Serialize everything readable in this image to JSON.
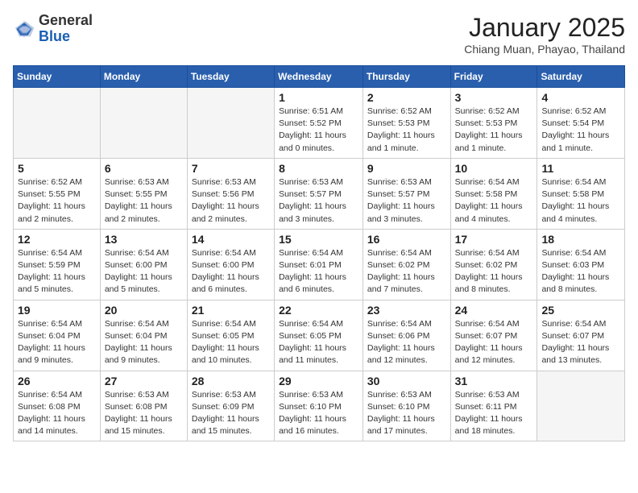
{
  "header": {
    "logo_general": "General",
    "logo_blue": "Blue",
    "title": "January 2025",
    "subtitle": "Chiang Muan, Phayao, Thailand"
  },
  "weekdays": [
    "Sunday",
    "Monday",
    "Tuesday",
    "Wednesday",
    "Thursday",
    "Friday",
    "Saturday"
  ],
  "weeks": [
    [
      {
        "day": "",
        "info": ""
      },
      {
        "day": "",
        "info": ""
      },
      {
        "day": "",
        "info": ""
      },
      {
        "day": "1",
        "info": "Sunrise: 6:51 AM\nSunset: 5:52 PM\nDaylight: 11 hours\nand 0 minutes."
      },
      {
        "day": "2",
        "info": "Sunrise: 6:52 AM\nSunset: 5:53 PM\nDaylight: 11 hours\nand 1 minute."
      },
      {
        "day": "3",
        "info": "Sunrise: 6:52 AM\nSunset: 5:53 PM\nDaylight: 11 hours\nand 1 minute."
      },
      {
        "day": "4",
        "info": "Sunrise: 6:52 AM\nSunset: 5:54 PM\nDaylight: 11 hours\nand 1 minute."
      }
    ],
    [
      {
        "day": "5",
        "info": "Sunrise: 6:52 AM\nSunset: 5:55 PM\nDaylight: 11 hours\nand 2 minutes."
      },
      {
        "day": "6",
        "info": "Sunrise: 6:53 AM\nSunset: 5:55 PM\nDaylight: 11 hours\nand 2 minutes."
      },
      {
        "day": "7",
        "info": "Sunrise: 6:53 AM\nSunset: 5:56 PM\nDaylight: 11 hours\nand 2 minutes."
      },
      {
        "day": "8",
        "info": "Sunrise: 6:53 AM\nSunset: 5:57 PM\nDaylight: 11 hours\nand 3 minutes."
      },
      {
        "day": "9",
        "info": "Sunrise: 6:53 AM\nSunset: 5:57 PM\nDaylight: 11 hours\nand 3 minutes."
      },
      {
        "day": "10",
        "info": "Sunrise: 6:54 AM\nSunset: 5:58 PM\nDaylight: 11 hours\nand 4 minutes."
      },
      {
        "day": "11",
        "info": "Sunrise: 6:54 AM\nSunset: 5:58 PM\nDaylight: 11 hours\nand 4 minutes."
      }
    ],
    [
      {
        "day": "12",
        "info": "Sunrise: 6:54 AM\nSunset: 5:59 PM\nDaylight: 11 hours\nand 5 minutes."
      },
      {
        "day": "13",
        "info": "Sunrise: 6:54 AM\nSunset: 6:00 PM\nDaylight: 11 hours\nand 5 minutes."
      },
      {
        "day": "14",
        "info": "Sunrise: 6:54 AM\nSunset: 6:00 PM\nDaylight: 11 hours\nand 6 minutes."
      },
      {
        "day": "15",
        "info": "Sunrise: 6:54 AM\nSunset: 6:01 PM\nDaylight: 11 hours\nand 6 minutes."
      },
      {
        "day": "16",
        "info": "Sunrise: 6:54 AM\nSunset: 6:02 PM\nDaylight: 11 hours\nand 7 minutes."
      },
      {
        "day": "17",
        "info": "Sunrise: 6:54 AM\nSunset: 6:02 PM\nDaylight: 11 hours\nand 8 minutes."
      },
      {
        "day": "18",
        "info": "Sunrise: 6:54 AM\nSunset: 6:03 PM\nDaylight: 11 hours\nand 8 minutes."
      }
    ],
    [
      {
        "day": "19",
        "info": "Sunrise: 6:54 AM\nSunset: 6:04 PM\nDaylight: 11 hours\nand 9 minutes."
      },
      {
        "day": "20",
        "info": "Sunrise: 6:54 AM\nSunset: 6:04 PM\nDaylight: 11 hours\nand 9 minutes."
      },
      {
        "day": "21",
        "info": "Sunrise: 6:54 AM\nSunset: 6:05 PM\nDaylight: 11 hours\nand 10 minutes."
      },
      {
        "day": "22",
        "info": "Sunrise: 6:54 AM\nSunset: 6:05 PM\nDaylight: 11 hours\nand 11 minutes."
      },
      {
        "day": "23",
        "info": "Sunrise: 6:54 AM\nSunset: 6:06 PM\nDaylight: 11 hours\nand 12 minutes."
      },
      {
        "day": "24",
        "info": "Sunrise: 6:54 AM\nSunset: 6:07 PM\nDaylight: 11 hours\nand 12 minutes."
      },
      {
        "day": "25",
        "info": "Sunrise: 6:54 AM\nSunset: 6:07 PM\nDaylight: 11 hours\nand 13 minutes."
      }
    ],
    [
      {
        "day": "26",
        "info": "Sunrise: 6:54 AM\nSunset: 6:08 PM\nDaylight: 11 hours\nand 14 minutes."
      },
      {
        "day": "27",
        "info": "Sunrise: 6:53 AM\nSunset: 6:08 PM\nDaylight: 11 hours\nand 15 minutes."
      },
      {
        "day": "28",
        "info": "Sunrise: 6:53 AM\nSunset: 6:09 PM\nDaylight: 11 hours\nand 15 minutes."
      },
      {
        "day": "29",
        "info": "Sunrise: 6:53 AM\nSunset: 6:10 PM\nDaylight: 11 hours\nand 16 minutes."
      },
      {
        "day": "30",
        "info": "Sunrise: 6:53 AM\nSunset: 6:10 PM\nDaylight: 11 hours\nand 17 minutes."
      },
      {
        "day": "31",
        "info": "Sunrise: 6:53 AM\nSunset: 6:11 PM\nDaylight: 11 hours\nand 18 minutes."
      },
      {
        "day": "",
        "info": ""
      }
    ]
  ]
}
